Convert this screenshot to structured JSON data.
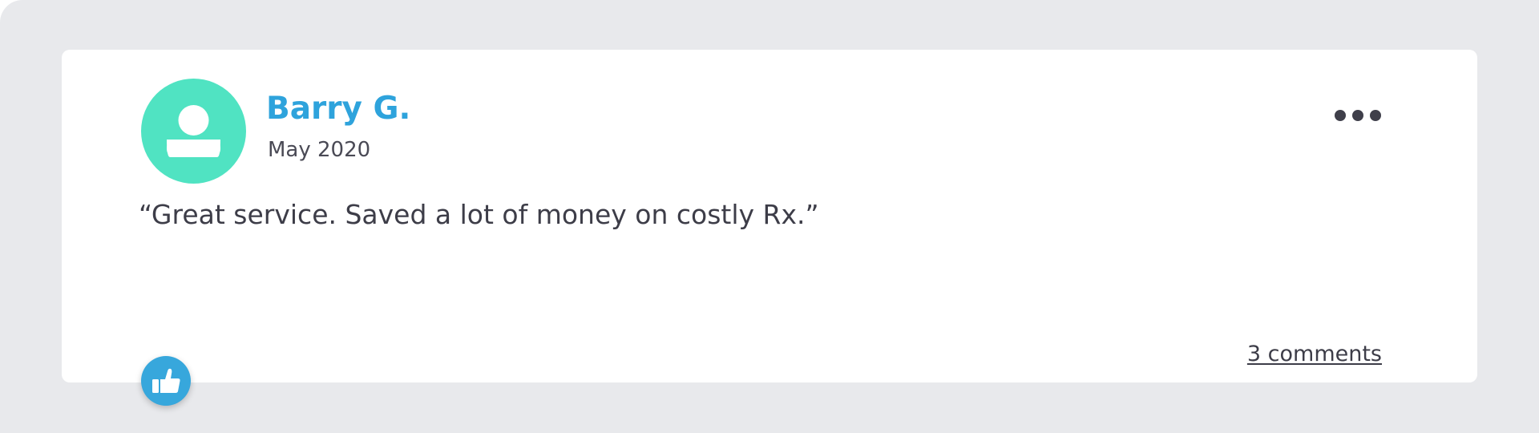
{
  "review": {
    "author_name": "Barry G.",
    "date": "May 2020",
    "text": "“Great service. Saved a lot of money on costly Rx.”",
    "comments_link": "3 comments"
  },
  "icons": {
    "avatar": "user-avatar-icon",
    "more": "more-options-icon",
    "like": "thumbs-up-icon"
  },
  "colors": {
    "background": "#e8e9ec",
    "card": "#ffffff",
    "avatar": "#50e3c2",
    "author_name": "#2ea3dc",
    "like_button": "#37a7dc",
    "text": "#3d3d48"
  }
}
